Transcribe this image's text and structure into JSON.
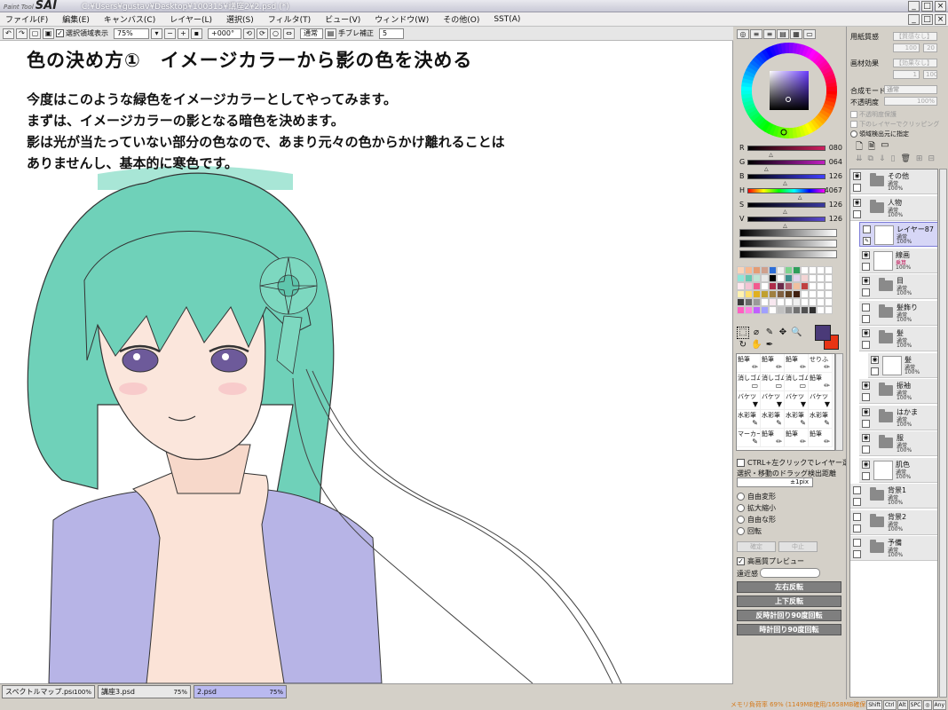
{
  "window": {
    "logo_small": "Paint Tool",
    "logo_big": "SAI",
    "title_path": "C:¥Users¥gustav¥Desktop¥100315¥講座2¥2.psd (*)",
    "controls": [
      "_",
      "□",
      "×"
    ]
  },
  "menu": {
    "items": [
      "ファイル(F)",
      "編集(E)",
      "キャンバス(C)",
      "レイヤー(L)",
      "選択(S)",
      "フィルタ(T)",
      "ビュー(V)",
      "ウィンドウ(W)",
      "その他(O)",
      "SST(A)"
    ]
  },
  "toolbar": {
    "selection_label": "選択領域表示",
    "zoom": "75%",
    "rotation": "+000°",
    "mode": "通常",
    "stabilizer_label": "手ブレ補正",
    "stabilizer_value": "5"
  },
  "canvas": {
    "title": "色の決め方①　イメージカラーから影の色を決める",
    "lines": [
      "今度はこのような緑色をイメージカラーとしてやってみます。",
      "まずは、イメージカラーの影となる暗色を決めます。",
      "影は光が当たっていない部分の色なので、あまり元々の色からかけ離れることは",
      "ありませんし、基本的に寒色です。"
    ],
    "colors": {
      "hair": "#6fd1b9",
      "skin": "#fbe3d7",
      "kimono": "#b7b4e6",
      "line": "#333333"
    }
  },
  "doc_tabs": [
    {
      "name": "スペクトルマップ.psd",
      "zoom": "100%"
    },
    {
      "name": "講座3.psd",
      "zoom": "75%"
    },
    {
      "name": "2.psd",
      "zoom": "75%"
    }
  ],
  "status": {
    "memory": "メモリ負荷率 69% (1149MB使用/1658MB確保)",
    "keys": [
      "Shift",
      "Ctrl",
      "Alt",
      "SPC",
      "◎",
      "Any"
    ]
  },
  "color_panel": {
    "sliders": [
      {
        "label": "R",
        "value": "080",
        "colors": [
          "#000000",
          "#d02060"
        ],
        "pos": 0.31
      },
      {
        "label": "G",
        "value": "064",
        "colors": [
          "#000000",
          "#c020c0"
        ],
        "pos": 0.25
      },
      {
        "label": "B",
        "value": "126",
        "colors": [
          "#000000",
          "#4040ff"
        ],
        "pos": 0.49
      },
      {
        "label": "H",
        "value": "4067",
        "colors": [
          "#ff0000",
          "#ff00ff"
        ],
        "pos": 0.68
      },
      {
        "label": "S",
        "value": "126",
        "colors": [
          "#000000",
          "#3a3aa0"
        ],
        "pos": 0.49
      },
      {
        "label": "V",
        "value": "126",
        "colors": [
          "#000000",
          "#5a4ad0"
        ],
        "pos": 0.49
      }
    ],
    "fg_color": "#4a3a78",
    "bg_color": "#e83414",
    "swatch_colors": [
      "#fbd3b8",
      "#f7b891",
      "#e49c74",
      "#cfa08d",
      "#2c6ed8",
      "#f0f0f0",
      "#7ed38f",
      "#2e9e5a",
      "#ffffff",
      "#ffffff",
      "#ffffff",
      "#ffffff",
      "#8fe6d8",
      "#66c8b0",
      "#bfe5d5",
      "#e8e8e8",
      "#000000",
      "#ffffff",
      "#3b8f8f",
      "#e4d4ec",
      "#f3d4d4",
      "#ffffff",
      "#ffffff",
      "#ffffff",
      "#ffe6ee",
      "#f4c4d4",
      "#f25b8f",
      "#ffffff",
      "#ae2c4a",
      "#6a2b4a",
      "#b06070",
      "#f0c0a0",
      "#c04040",
      "#ffffff",
      "#ffffff",
      "#ffffff",
      "#fff2b0",
      "#ffe070",
      "#e0b020",
      "#c0a030",
      "#a08040",
      "#806040",
      "#604020",
      "#402010",
      "#ffffff",
      "#ffffff",
      "#ffffff",
      "#ffffff",
      "#3a3a3a",
      "#6a6a6a",
      "#9a9a9a",
      "#ffffff",
      "#f8e8f0",
      "#ffffff",
      "#ffffff",
      "#f0f0f0",
      "#ffffff",
      "#ffffff",
      "#ffffff",
      "#ffffff",
      "#ff60c0",
      "#ff80e0",
      "#c060ff",
      "#a0a0ff",
      "#ffffff",
      "#c0c0c0",
      "#909090",
      "#707070",
      "#505050",
      "#303030",
      "#ffffff",
      "#ffffff"
    ],
    "tools": [
      "⬚",
      "⌀",
      "✎",
      "☐",
      "✥",
      "🔍",
      "↻",
      "✋",
      "⟳",
      "✒"
    ],
    "brushes": [
      {
        "name": "鉛筆",
        "icon": "✏"
      },
      {
        "name": "鉛筆",
        "icon": "✏"
      },
      {
        "name": "鉛筆",
        "icon": "✏"
      },
      {
        "name": "せりふ",
        "icon": "✏"
      },
      {
        "name": "消しゴム",
        "icon": "▭"
      },
      {
        "name": "消しゴム",
        "icon": "▭"
      },
      {
        "name": "消しゴム",
        "icon": "▭"
      },
      {
        "name": "鉛筆",
        "icon": "✏"
      },
      {
        "name": "バケツ",
        "icon": "▼"
      },
      {
        "name": "バケツ",
        "icon": "▼"
      },
      {
        "name": "バケツ",
        "icon": "▼"
      },
      {
        "name": "バケツ",
        "icon": "▼"
      },
      {
        "name": "水彩筆",
        "icon": "✎"
      },
      {
        "name": "水彩筆",
        "icon": "✎"
      },
      {
        "name": "水彩筆",
        "icon": "✎"
      },
      {
        "name": "水彩筆",
        "icon": "✎"
      },
      {
        "name": "マーカー",
        "icon": "✎"
      },
      {
        "name": "鉛筆",
        "icon": "✏"
      },
      {
        "name": "鉛筆",
        "icon": "✏"
      },
      {
        "name": "鉛筆",
        "icon": "✏"
      }
    ],
    "ctrl_label": "CTRL+左クリックでレイヤー選択",
    "drag_label": "選択・移動のドラッグ検出距離",
    "drag_value": "±1pix",
    "transform_options": [
      "自由変形",
      "拡大縮小",
      "自由な形",
      "回転"
    ],
    "ok_label": "確定",
    "cancel_label": "中止",
    "preview_label": "高画質プレビュー",
    "near_label": "遠近感",
    "buttons": [
      "左右反転",
      "上下反転",
      "反時計回り90度回転",
      "時計回り90度回転"
    ]
  },
  "layer_panel": {
    "paper_label": "用紙質感",
    "paper_value": "【質感なし】",
    "paper_num": "100",
    "paper_num2": "20",
    "effect_label": "画材効果",
    "effect_value": "【効果なし】",
    "effect_num": "1",
    "effect_num2": "100",
    "blend_label": "合成モード",
    "blend_value": "通常",
    "opacity_label": "不透明度",
    "opacity_value": "100%",
    "check1": "不透明度保護",
    "check2": "下のレイヤーでクリッピング",
    "check3": "領域検出元に指定",
    "layers": [
      {
        "name": "その他",
        "mode": "通常",
        "opacity": "100%",
        "type": "folder",
        "indent": 0,
        "visible": true
      },
      {
        "name": "人物",
        "mode": "通常",
        "opacity": "100%",
        "type": "folder",
        "indent": 0,
        "visible": true
      },
      {
        "name": "レイヤー87",
        "mode": "通常",
        "opacity": "100%",
        "type": "layer",
        "indent": 1,
        "visible": false,
        "selected": true
      },
      {
        "name": "線画",
        "mode": "乗算",
        "opacity": "100%",
        "type": "layer",
        "indent": 1,
        "visible": true
      },
      {
        "name": "目",
        "mode": "通常",
        "opacity": "100%",
        "type": "folder",
        "indent": 1,
        "visible": true
      },
      {
        "name": "髪飾り",
        "mode": "通常",
        "opacity": "100%",
        "type": "folder",
        "indent": 1,
        "visible": false
      },
      {
        "name": "髪",
        "mode": "通常",
        "opacity": "100%",
        "type": "folder",
        "indent": 1,
        "visible": true
      },
      {
        "name": "髪",
        "mode": "通常",
        "opacity": "100%",
        "type": "layer",
        "indent": 2,
        "visible": true
      },
      {
        "name": "振袖",
        "mode": "通常",
        "opacity": "100%",
        "type": "folder",
        "indent": 1,
        "visible": true
      },
      {
        "name": "はかま",
        "mode": "通常",
        "opacity": "100%",
        "type": "folder",
        "indent": 1,
        "visible": true
      },
      {
        "name": "服",
        "mode": "通常",
        "opacity": "100%",
        "type": "folder",
        "indent": 1,
        "visible": true
      },
      {
        "name": "肌色",
        "mode": "通常",
        "opacity": "100%",
        "type": "layer",
        "indent": 1,
        "visible": true
      },
      {
        "name": "背景1",
        "mode": "通常",
        "opacity": "100%",
        "type": "folder",
        "indent": 0,
        "visible": false
      },
      {
        "name": "背景2",
        "mode": "通常",
        "opacity": "100%",
        "type": "folder",
        "indent": 0,
        "visible": false
      },
      {
        "name": "予備",
        "mode": "通常",
        "opacity": "100%",
        "type": "folder",
        "indent": 0,
        "visible": false
      }
    ]
  }
}
